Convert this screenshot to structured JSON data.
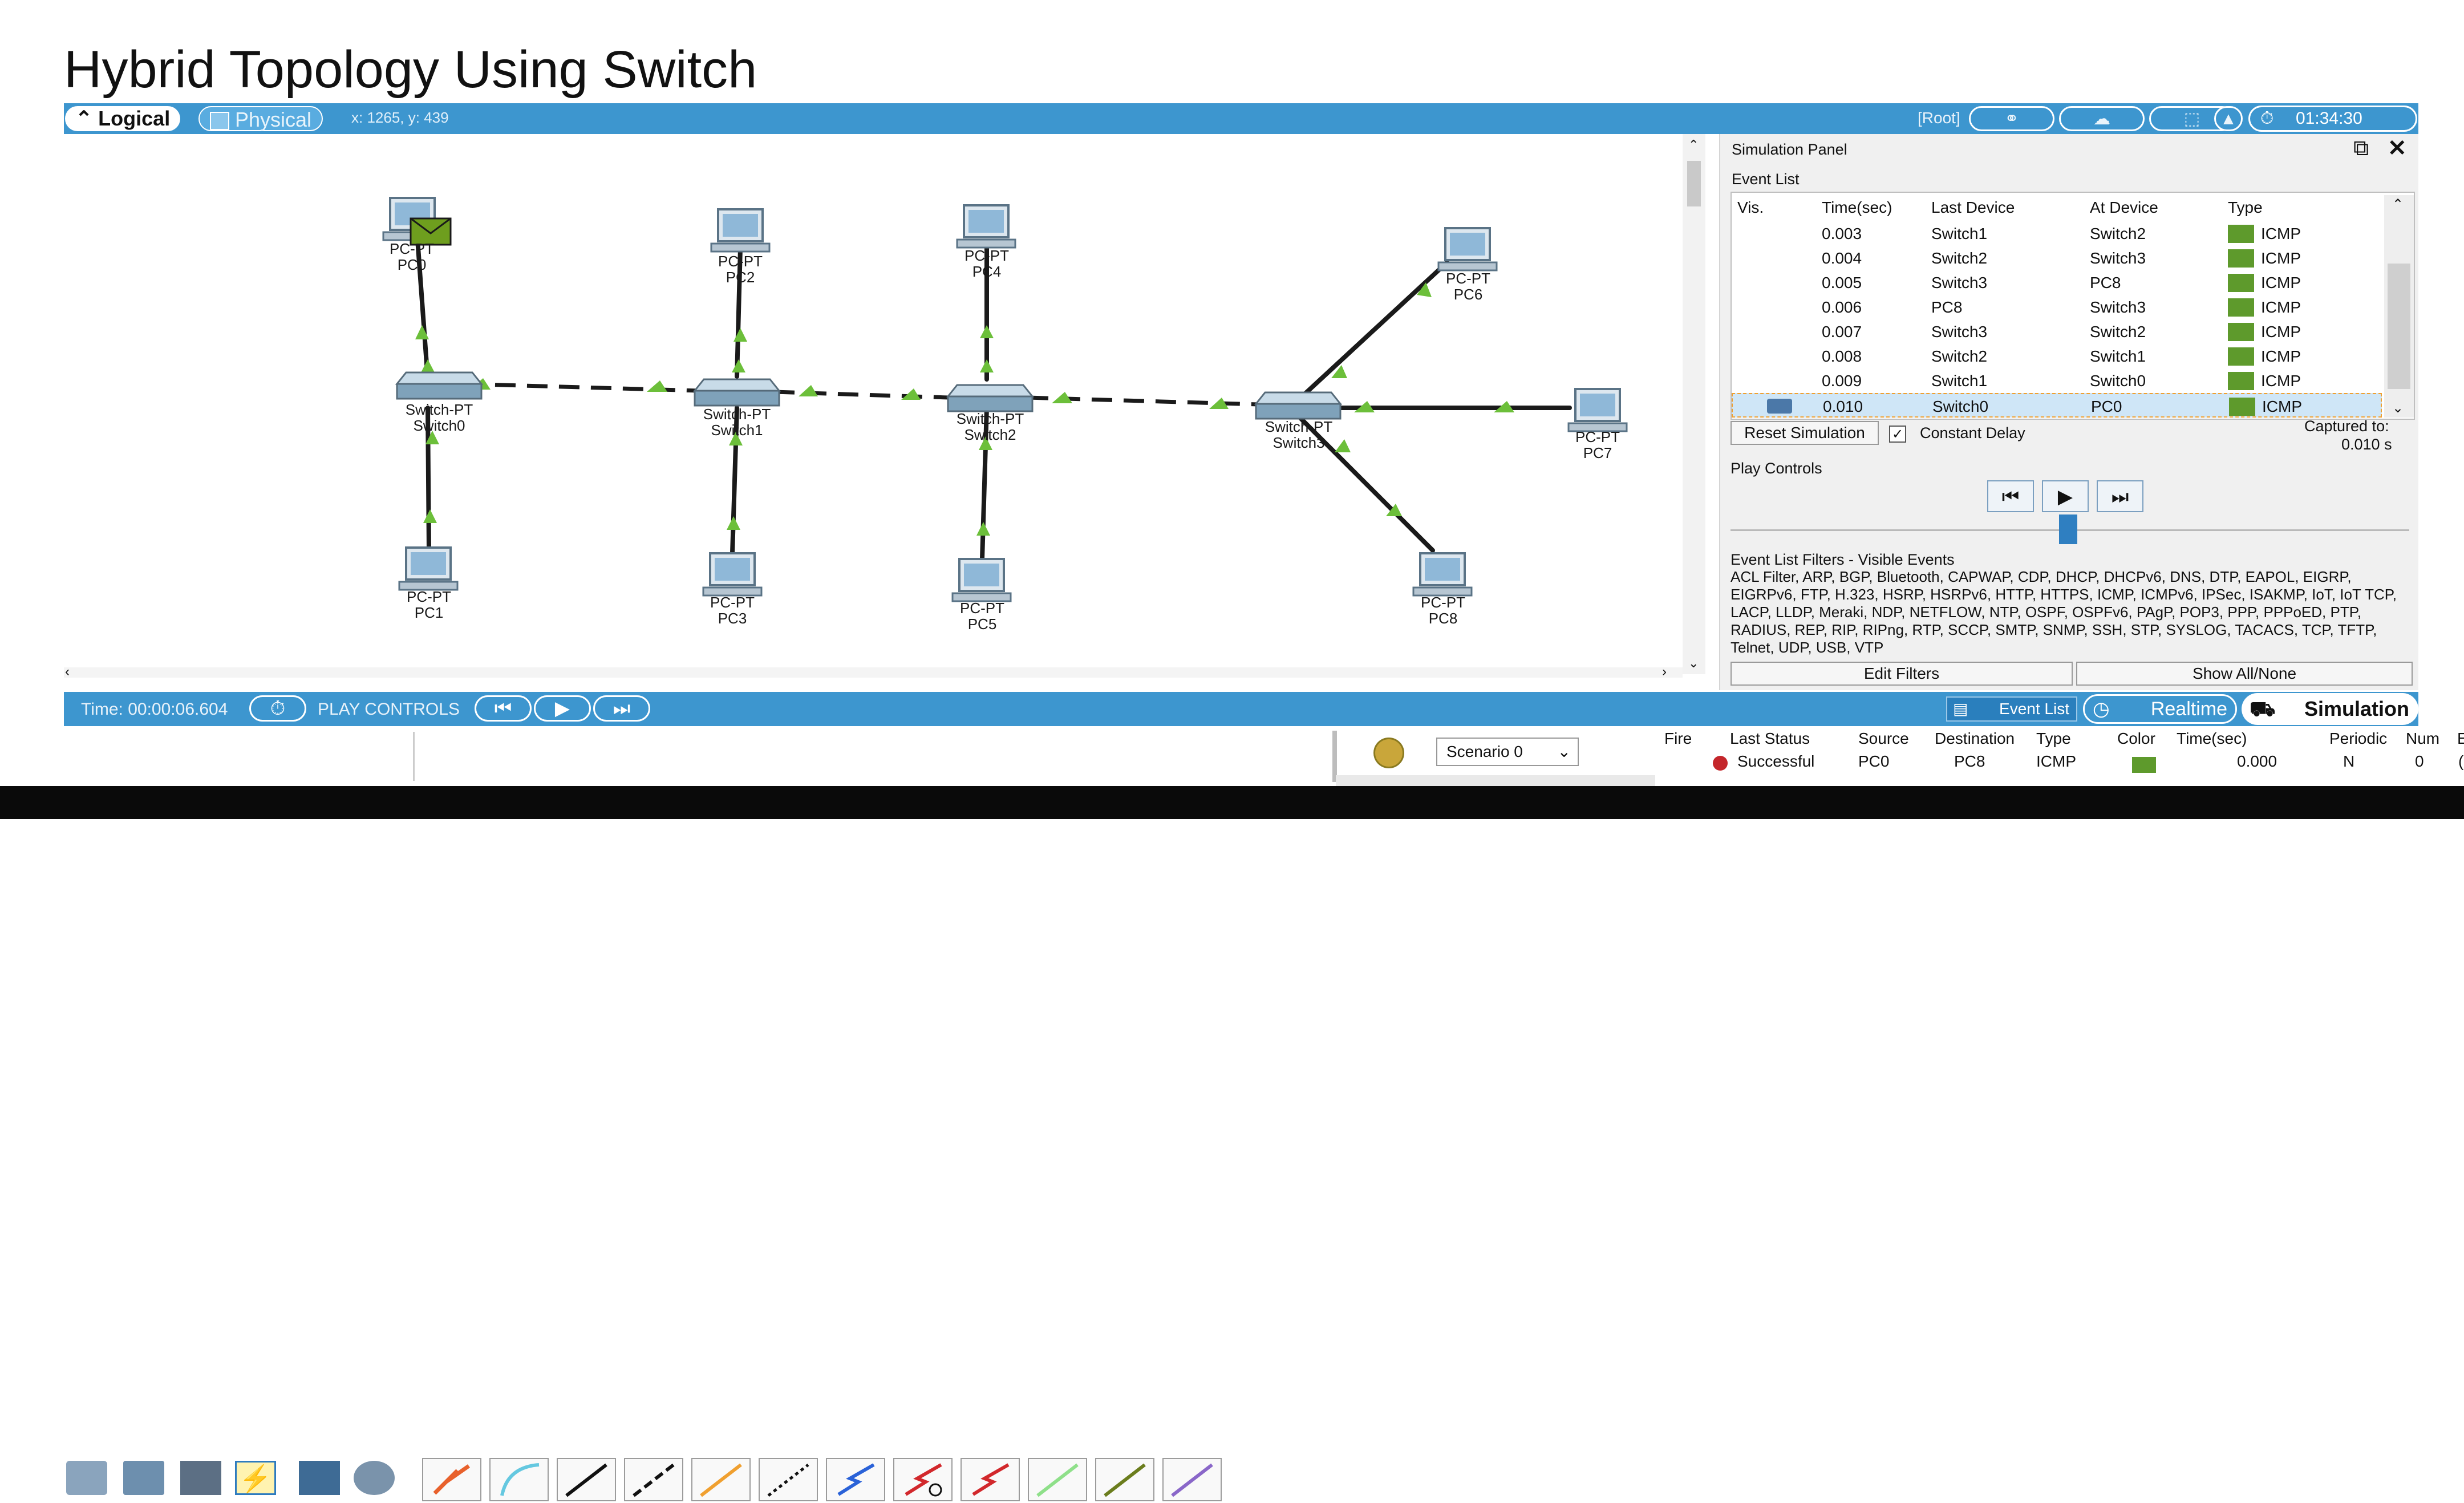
{
  "slide": {
    "title": "Hybrid Topology Using Switch"
  },
  "topbar": {
    "logical": "Logical",
    "physical": "Physical",
    "coords": "x: 1265, y: 439",
    "root": "[Root]",
    "time": "01:34:30",
    "accent": "#3d96cf"
  },
  "topology": {
    "devices": [
      {
        "type": "PC-PT",
        "name": "PC0"
      },
      {
        "type": "PC-PT",
        "name": "PC2"
      },
      {
        "type": "PC-PT",
        "name": "PC4"
      },
      {
        "type": "PC-PT",
        "name": "PC6"
      },
      {
        "type": "Switch-PT",
        "name": "Switch0"
      },
      {
        "type": "Switch-PT",
        "name": "Switch1"
      },
      {
        "type": "Switch-PT",
        "name": "Switch2"
      },
      {
        "type": "Switch-PT",
        "name": "Switch3"
      },
      {
        "type": "PC-PT",
        "name": "PC7"
      },
      {
        "type": "PC-PT",
        "name": "PC1"
      },
      {
        "type": "PC-PT",
        "name": "PC3"
      },
      {
        "type": "PC-PT",
        "name": "PC5"
      },
      {
        "type": "PC-PT",
        "name": "PC8"
      }
    ]
  },
  "simpanel": {
    "title": "Simulation Panel",
    "event_list": "Event List",
    "columns": [
      "Vis.",
      "Time(sec)",
      "Last Device",
      "At Device",
      "Type"
    ],
    "rows": [
      {
        "time": "0.003",
        "last": "Switch1",
        "at": "Switch2",
        "type": "ICMP"
      },
      {
        "time": "0.004",
        "last": "Switch2",
        "at": "Switch3",
        "type": "ICMP"
      },
      {
        "time": "0.005",
        "last": "Switch3",
        "at": "PC8",
        "type": "ICMP"
      },
      {
        "time": "0.006",
        "last": "PC8",
        "at": "Switch3",
        "type": "ICMP"
      },
      {
        "time": "0.007",
        "last": "Switch3",
        "at": "Switch2",
        "type": "ICMP"
      },
      {
        "time": "0.008",
        "last": "Switch2",
        "at": "Switch1",
        "type": "ICMP"
      },
      {
        "time": "0.009",
        "last": "Switch1",
        "at": "Switch0",
        "type": "ICMP"
      },
      {
        "time": "0.010",
        "last": "Switch0",
        "at": "PC0",
        "type": "ICMP"
      }
    ],
    "reset": "Reset Simulation",
    "constant_delay": "Constant Delay",
    "captured_label": "Captured to:",
    "captured_value": "0.010 s",
    "play_controls": "Play Controls",
    "filters_title": "Event List Filters - Visible Events",
    "filters_text": "ACL Filter, ARP, BGP, Bluetooth, CAPWAP, CDP, DHCP, DHCPv6, DNS, DTP, EAPOL, EIGRP, EIGRPv6, FTP, H.323, HSRP, HSRPv6, HTTP, HTTPS, ICMP, ICMPv6, IPSec, ISAKMP, IoT, IoT TCP, LACP, LLDP, Meraki, NDP, NETFLOW, NTP, OSPF, OSPFv6, PAgP, POP3, PPP, PPPoED, PTP, RADIUS, REP, RIP, RIPng, RTP, SCCP, SMTP, SNMP, SSH, STP, SYSLOG, TACACS, TCP, TFTP, Telnet, UDP, USB, VTP",
    "edit_filters": "Edit Filters",
    "show_all": "Show All/None"
  },
  "bottombar": {
    "time": "Time: 00:00:06.604",
    "play_controls": "PLAY CONTROLS",
    "event_list": "Event List",
    "realtime": "Realtime",
    "simulation": "Simulation"
  },
  "scenario": {
    "label": "Scenario 0"
  },
  "pdu": {
    "columns": [
      "Fire",
      "Last Status",
      "Source",
      "Destination",
      "Type",
      "Color",
      "Time(sec)",
      "Periodic",
      "Num",
      "Ed"
    ],
    "row": {
      "status": "Successful",
      "source": "PC0",
      "destination": "PC8",
      "type": "ICMP",
      "time": "0.000",
      "periodic": "N",
      "num": "0",
      "edit": "(e"
    }
  },
  "colors": {
    "icmp": "#5e9a2c",
    "link": "#1a1a1a",
    "arrow": "#6cbf3a",
    "highlight": "#3d96cf"
  }
}
